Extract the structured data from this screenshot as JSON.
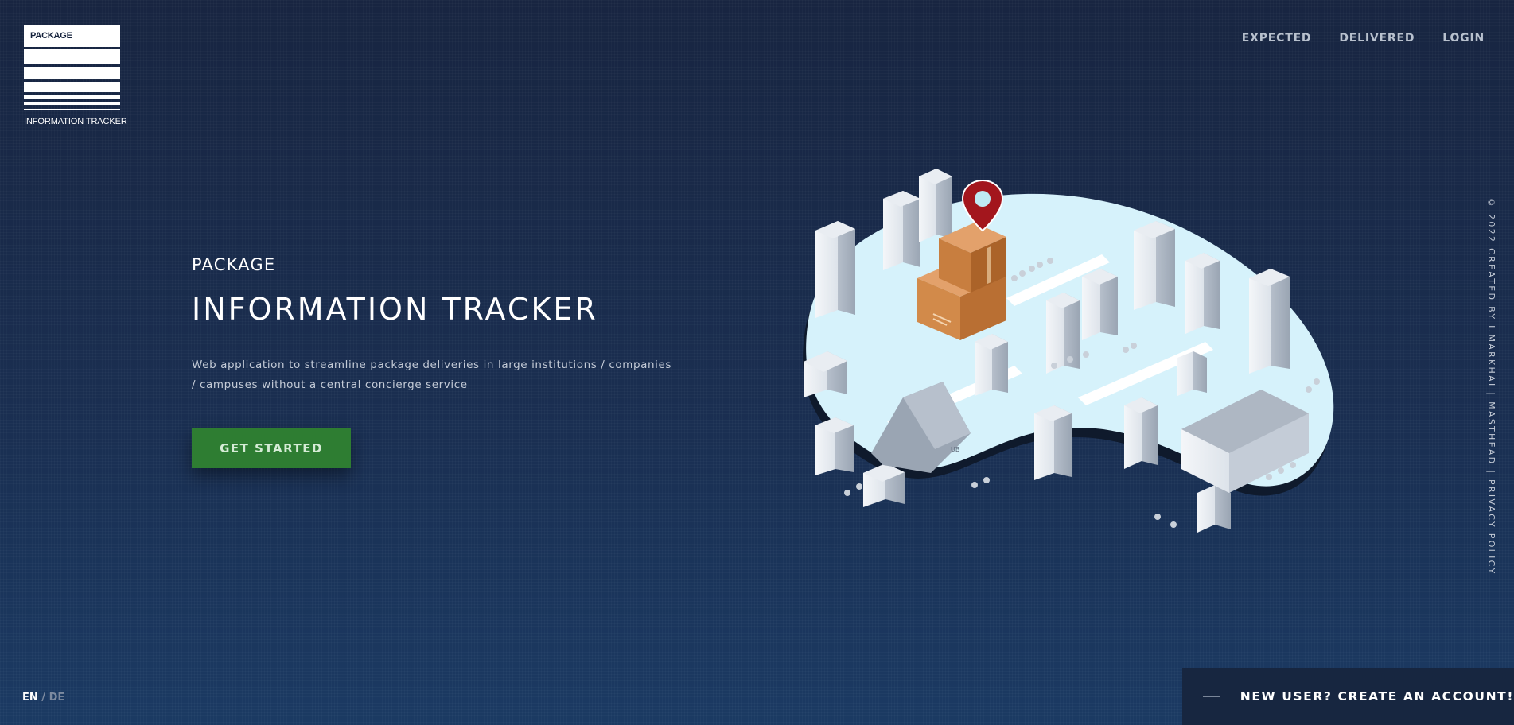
{
  "logo": {
    "box_text": "PACKAGE",
    "subtitle": "INFORMATION TRACKER"
  },
  "nav": {
    "items": [
      "EXPECTED",
      "DELIVERED",
      "LOGIN"
    ]
  },
  "hero": {
    "kicker": "PACKAGE",
    "title": "INFORMATION TRACKER",
    "description_line1": "Web application to streamline package deliveries in large institutions / companies",
    "description_line2": "/ campuses without a central concierge service",
    "cta_label": "GET STARTED"
  },
  "credits": "© 2022 CREATED BY I.MARKHAI | MASTHEAD | PRIVACY POLICY",
  "language": {
    "active": "EN",
    "separator": "/",
    "inactive": "DE"
  },
  "new_user": {
    "label": "NEW USER? CREATE AN ACCOUNT!"
  },
  "illustration": {
    "pin_icon": "map-pin-icon",
    "box_icon": "package-box-icon",
    "building_label": "UB"
  },
  "colors": {
    "background": "#182541",
    "cta": "#2e7d32",
    "pin": "#a3161d",
    "island": "#d6f2fb",
    "box": "#d28a4a"
  }
}
